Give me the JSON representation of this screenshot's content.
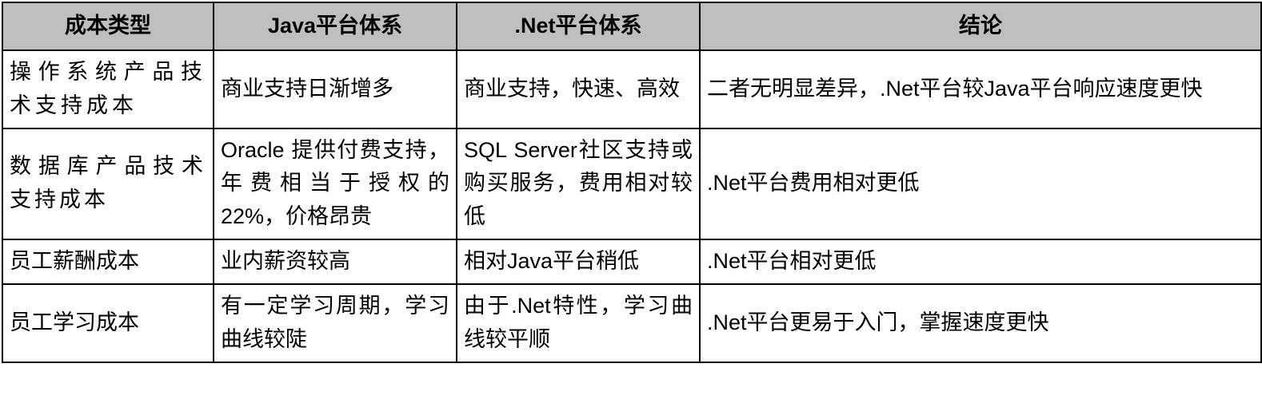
{
  "table": {
    "headers": [
      "成本类型",
      "Java平台体系",
      ".Net平台体系",
      "结论"
    ],
    "rows": [
      {
        "cost_type": "操作系统产品技术支持成本",
        "java": "商业支持日渐增多",
        "dotnet": "商业支持，快速、高效",
        "conclusion": "二者无明显差异，.Net平台较Java平台响应速度更快"
      },
      {
        "cost_type": "数据库产品技术支持成本",
        "java": "Oracle 提供付费支持，年费相当于授权的22%，价格昂贵",
        "dotnet": "SQL Server社区支持或购买服务，费用相对较低",
        "conclusion": ".Net平台费用相对更低"
      },
      {
        "cost_type": "员工薪酬成本",
        "java": "业内薪资较高",
        "dotnet": "相对Java平台稍低",
        "conclusion": ".Net平台相对更低"
      },
      {
        "cost_type": "员工学习成本",
        "java": "有一定学习周期，学习曲线较陡",
        "dotnet": "由于.Net特性，学习曲线较平顺",
        "conclusion": ".Net平台更易于入门，掌握速度更快"
      }
    ]
  }
}
